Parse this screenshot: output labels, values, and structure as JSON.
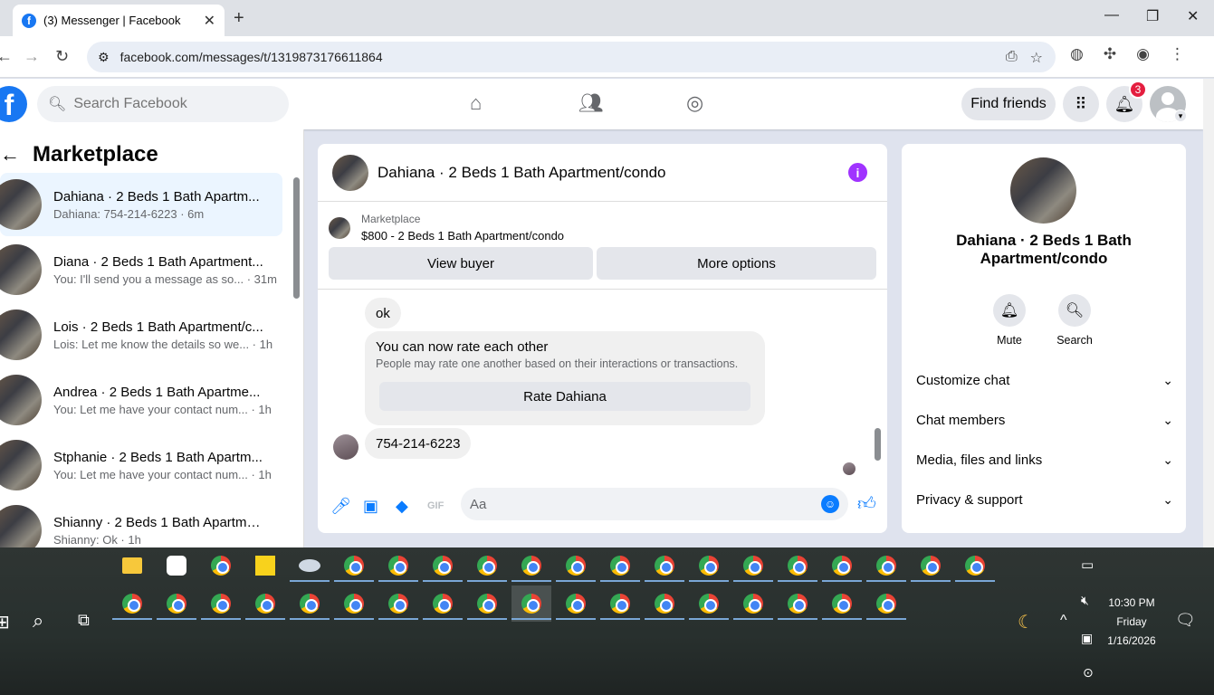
{
  "browser": {
    "tab_title": "(3) Messenger | Facebook",
    "url": "facebook.com/messages/t/1319873176611864"
  },
  "header": {
    "search_placeholder": "Search Facebook",
    "find_friends": "Find friends",
    "notification_count": "3"
  },
  "left": {
    "title": "Marketplace",
    "conversations": [
      {
        "name": "Dahiana · 2 Beds 1 Bath Apartm...",
        "preview": "Dahiana: 754-214-6223 · 6m",
        "active": true
      },
      {
        "name": "Diana · 2 Beds 1 Bath Apartment...",
        "preview": "You: I'll send you a message as so... · 31m"
      },
      {
        "name": "Lois · 2 Beds 1 Bath Apartment/c...",
        "preview": "Lois: Let me know the details so we... · 1h"
      },
      {
        "name": "Andrea · 2 Beds 1 Bath Apartme...",
        "preview": "You: Let me have your contact num... · 1h"
      },
      {
        "name": "Stphanie · 2 Beds 1 Bath Apartm...",
        "preview": "You: Let me have your contact num... · 1h"
      },
      {
        "name": "Shianny · 2 Beds 1 Bath Apartme...",
        "preview": "Shianny: Ok · 1h"
      }
    ]
  },
  "chat": {
    "title": "Dahiana · 2 Beds 1 Bath Apartment/condo",
    "marketplace_label": "Marketplace",
    "listing": "$800 - 2 Beds 1 Bath Apartment/condo",
    "view_buyer": "View buyer",
    "more_options": "More options",
    "msg_ok": "ok",
    "rate_title": "You can now rate each other",
    "rate_sub": "People may rate one another based on their interactions or transactions.",
    "rate_button": "Rate Dahiana",
    "msg_phone": "754-214-6223",
    "composer_placeholder": "Aa"
  },
  "right": {
    "name": "Dahiana · 2 Beds 1 Bath Apartment/condo",
    "mute": "Mute",
    "search": "Search",
    "rows": [
      "Customize chat",
      "Chat members",
      "Media, files and links",
      "Privacy & support"
    ]
  },
  "taskbar": {
    "time": "10:30 PM",
    "day": "Friday",
    "date": "1/16/2026"
  }
}
